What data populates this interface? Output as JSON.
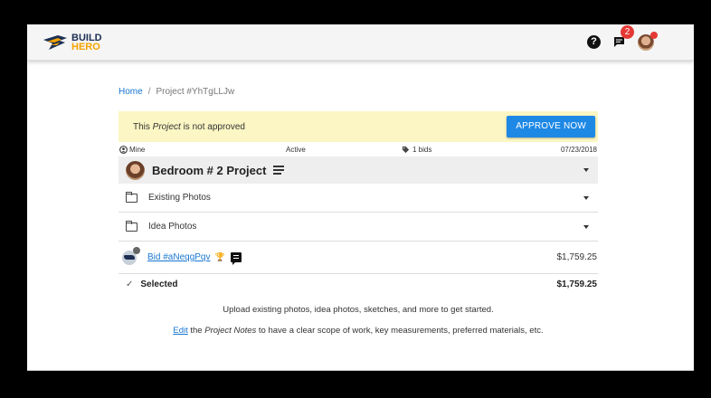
{
  "brand": {
    "line1": "BUILD",
    "line2": "HERO"
  },
  "header": {
    "help": "?",
    "message_badge": "2"
  },
  "breadcrumb": {
    "home": "Home",
    "separator": "/",
    "current": "Project #YhTgLLJw"
  },
  "alert": {
    "prefix": "This ",
    "emphasis": "Project",
    "suffix": " is not approved",
    "button": "APPROVE NOW"
  },
  "meta": {
    "owner": "Mine",
    "status": "Active",
    "bids": "1 bids",
    "date": "07/23/2018"
  },
  "project": {
    "title": "Bedroom # 2 Project"
  },
  "folders": [
    {
      "label": "Existing Photos"
    },
    {
      "label": "Idea Photos"
    }
  ],
  "bid": {
    "label": "Bid #aNeqgPqv",
    "amount": "$1,759.25"
  },
  "selected": {
    "label": "Selected",
    "amount": "$1,759.25"
  },
  "info": {
    "upload": "Upload existing photos, idea photos, sketches, and more to get started.",
    "edit_link": "Edit",
    "edit_mid": " the ",
    "edit_emphasis": "Project Notes",
    "edit_rest": " to have a clear scope of work, key measurements, preferred materials, etc."
  },
  "colors": {
    "accent": "#1e88e5",
    "alert_bg": "#fbf6c3",
    "brand_navy": "#1c2f52",
    "brand_orange": "#f5a300",
    "badge": "#e53935"
  }
}
